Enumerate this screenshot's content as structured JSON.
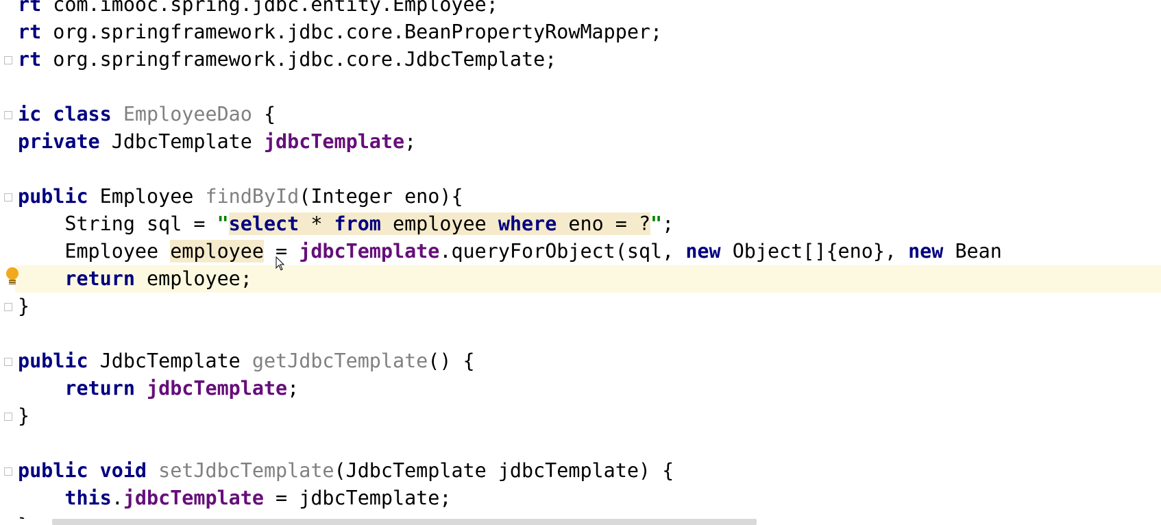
{
  "editor": {
    "colors": {
      "keyword": "#000080",
      "field": "#660e7a",
      "unused": "#808080",
      "string": "#008000",
      "current_line": "#fdf9e1",
      "identifier_highlight": "#f5eacb"
    },
    "gutter": {
      "intention_icon": "lightbulb-icon",
      "fold_icon": "fold-marker-icon"
    },
    "lines": [
      {
        "tokens": [
          {
            "text": "rt",
            "kind": "kw"
          },
          {
            "text": " com.imooc.spring.jdbc.entity.Employee;",
            "kind": "plain"
          }
        ]
      },
      {
        "tokens": [
          {
            "text": "rt",
            "kind": "kw"
          },
          {
            "text": " org.springframework.jdbc.core.BeanPropertyRowMapper;",
            "kind": "plain"
          }
        ]
      },
      {
        "tokens": [
          {
            "text": "rt",
            "kind": "kw"
          },
          {
            "text": " org.springframework.jdbc.core.JdbcTemplate;",
            "kind": "plain"
          }
        ]
      },
      {
        "tokens": []
      },
      {
        "tokens": [
          {
            "text": "ic class",
            "kind": "kw"
          },
          {
            "text": " ",
            "kind": "plain"
          },
          {
            "text": "EmployeeDao",
            "kind": "unused"
          },
          {
            "text": " {",
            "kind": "plain"
          }
        ]
      },
      {
        "tokens": [
          {
            "text": "private",
            "kind": "kw"
          },
          {
            "text": " JdbcTemplate ",
            "kind": "plain"
          },
          {
            "text": "jdbcTemplate",
            "kind": "fld"
          },
          {
            "text": ";",
            "kind": "plain"
          }
        ]
      },
      {
        "tokens": []
      },
      {
        "tokens": [
          {
            "text": "public",
            "kind": "kw"
          },
          {
            "text": " Employee ",
            "kind": "plain"
          },
          {
            "text": "findById",
            "kind": "unused"
          },
          {
            "text": "(Integer eno){",
            "kind": "plain"
          }
        ]
      },
      {
        "tokens": [
          {
            "text": "    String sql = ",
            "kind": "plain"
          },
          {
            "text": "\"",
            "kind": "str"
          },
          {
            "text": "select",
            "kind": "kw",
            "hl": true
          },
          {
            "text": " * ",
            "kind": "plain",
            "hl": true
          },
          {
            "text": "from",
            "kind": "kw",
            "hl": true
          },
          {
            "text": " employee ",
            "kind": "plain",
            "hl": true
          },
          {
            "text": "where",
            "kind": "kw",
            "hl": true
          },
          {
            "text": " eno = ?",
            "kind": "plain",
            "hl": true
          },
          {
            "text": "\"",
            "kind": "str"
          },
          {
            "text": ";",
            "kind": "plain"
          }
        ]
      },
      {
        "tokens": [
          {
            "text": "    Employee ",
            "kind": "plain"
          },
          {
            "text": "employee",
            "kind": "plain",
            "hl": true
          },
          {
            "text": " = ",
            "kind": "plain"
          },
          {
            "text": "jdbcTemplate",
            "kind": "fld"
          },
          {
            "text": ".queryForObject(sql, ",
            "kind": "plain"
          },
          {
            "text": "new",
            "kind": "kw"
          },
          {
            "text": " Object[]{eno}, ",
            "kind": "plain"
          },
          {
            "text": "new",
            "kind": "kw"
          },
          {
            "text": " Bean",
            "kind": "plain"
          }
        ]
      },
      {
        "tokens": [
          {
            "text": "    ",
            "kind": "plain"
          },
          {
            "text": "return",
            "kind": "kw"
          },
          {
            "text": " employee;",
            "kind": "plain"
          }
        ],
        "current": true
      },
      {
        "tokens": [
          {
            "text": "}",
            "kind": "plain"
          }
        ]
      },
      {
        "tokens": []
      },
      {
        "tokens": [
          {
            "text": "public",
            "kind": "kw"
          },
          {
            "text": " JdbcTemplate ",
            "kind": "plain"
          },
          {
            "text": "getJdbcTemplate",
            "kind": "unused"
          },
          {
            "text": "() {",
            "kind": "plain"
          }
        ]
      },
      {
        "tokens": [
          {
            "text": "    ",
            "kind": "plain"
          },
          {
            "text": "return",
            "kind": "kw"
          },
          {
            "text": " ",
            "kind": "plain"
          },
          {
            "text": "jdbcTemplate",
            "kind": "fld"
          },
          {
            "text": ";",
            "kind": "plain"
          }
        ]
      },
      {
        "tokens": [
          {
            "text": "}",
            "kind": "plain"
          }
        ]
      },
      {
        "tokens": []
      },
      {
        "tokens": [
          {
            "text": "public void",
            "kind": "kw"
          },
          {
            "text": " ",
            "kind": "plain"
          },
          {
            "text": "setJdbcTemplate",
            "kind": "unused"
          },
          {
            "text": "(JdbcTemplate jdbcTemplate) {",
            "kind": "plain"
          }
        ]
      },
      {
        "tokens": [
          {
            "text": "    ",
            "kind": "plain"
          },
          {
            "text": "this",
            "kind": "kw"
          },
          {
            "text": ".",
            "kind": "plain"
          },
          {
            "text": "jdbcTemplate",
            "kind": "fld"
          },
          {
            "text": " = jdbcTemplate;",
            "kind": "plain"
          }
        ]
      },
      {
        "tokens": [
          {
            "text": "}",
            "kind": "plain"
          }
        ]
      }
    ]
  }
}
